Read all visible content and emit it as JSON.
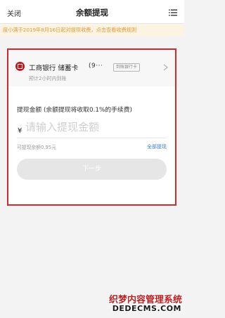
{
  "header": {
    "close_label": "关闭",
    "title": "余额提现"
  },
  "notice": {
    "text": "度小满于2019年8月16日起对提现收费，点击查看收费规则"
  },
  "bank": {
    "name": "工商银行 储蓄卡",
    "card_number": "(9···",
    "tag": "到账银行卡",
    "arrival_note": "预计2小时内到账"
  },
  "withdraw": {
    "amount_label": "提现金额 (余额提现将收取0.1%的手续费)",
    "currency_symbol": "¥",
    "placeholder": "请输入提现金额",
    "balance_note": "可提现余额0.95元",
    "withdraw_all_label": "全部提现",
    "next_label": "下一步"
  },
  "watermark": {
    "line1": "织梦内容管理系统",
    "line2": "DEDECMS.COM"
  },
  "colors": {
    "notice_text": "#e39a3a",
    "notice_bg": "#fdf3e3",
    "highlight_frame": "#d12a2a",
    "link": "#3a7de0",
    "bank_logo": "#c4161c"
  }
}
